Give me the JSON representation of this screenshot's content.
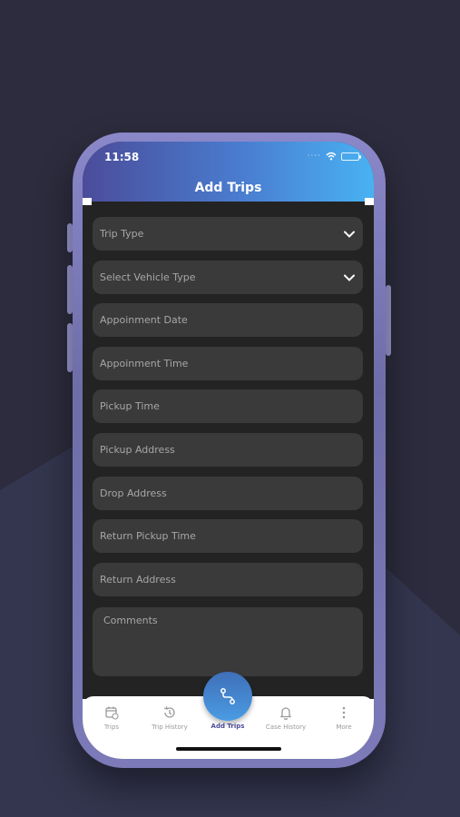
{
  "status_bar": {
    "time": "11:58"
  },
  "header": {
    "title": "Add Trips"
  },
  "form": {
    "trip_type": "Trip Type",
    "vehicle_type": "Select Vehicle Type",
    "appointment_date": "Appoinment Date",
    "appointment_time": "Appoinment Time",
    "pickup_time": "Pickup Time",
    "pickup_address": "Pickup Address",
    "drop_address": "Drop Address",
    "return_pickup_time": "Return Pickup Time",
    "return_address": "Return Address",
    "comments": "Comments"
  },
  "tabs": {
    "trips": "Trips",
    "trip_history": "Trip History",
    "add_trips": "Add Trips",
    "case_history": "Case History",
    "more": "More"
  },
  "icons": [
    "wifi-icon",
    "battery-icon",
    "chevron-down-icon",
    "calendar-icon",
    "history-icon",
    "route-icon",
    "bell-icon",
    "more-vertical-icon"
  ],
  "colors": {
    "background": "#2d2c3e",
    "header_start": "#4b4c9a",
    "header_end": "#49b2f2",
    "field": "#3a3a3a",
    "active_tab": "#4d4e9a"
  }
}
